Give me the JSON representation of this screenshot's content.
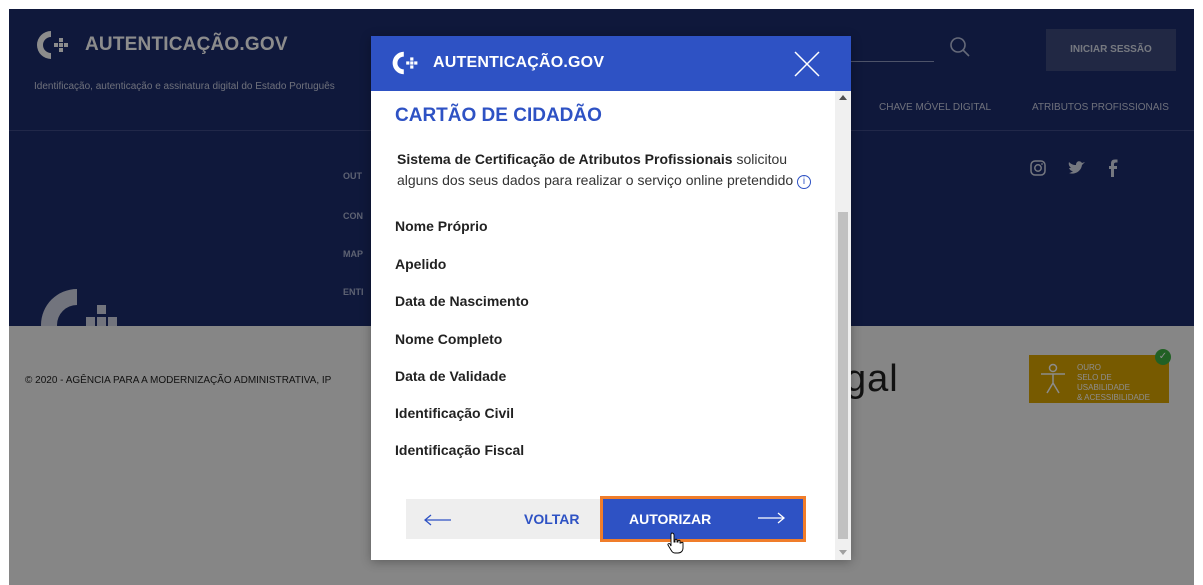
{
  "site": {
    "logo_text": "AUTENTICAÇÃO.GOV",
    "tagline": "Identificação, autenticação e assinatura digital do Estado Português",
    "login_button": "INICIAR SESSÃO",
    "nav": [
      "CHAVE MÓVEL DIGITAL",
      "ATRIBUTOS PROFISSIONAIS"
    ],
    "footer_menu_fragments": [
      "OUT",
      "CON",
      "MAP",
      "ENTI"
    ],
    "copyright": "© 2020 - AGÊNCIA PARA A MODERNIZAÇÃO ADMINISTRATIVA, IP",
    "portugal_fragment": "gal",
    "badge": {
      "line1": "OURO",
      "line2": "SELO DE USABILIDADE",
      "line3": "& ACESSIBILIDADE"
    }
  },
  "modal": {
    "logo_text": "AUTENTICAÇÃO.GOV",
    "title": "CARTÃO DE CIDADÃO",
    "intro_bold": "Sistema de Certificação de Atributos Profissionais",
    "intro_rest": " solicitou alguns dos seus dados para realizar o serviço online pretendido",
    "attributes": [
      "Nome Próprio",
      "Apelido",
      "Data de Nascimento",
      "Nome Completo",
      "Data de Validade",
      "Identificação Civil",
      "Identificação Fiscal"
    ],
    "back_label": "VOLTAR",
    "authorize_label": "AUTORIZAR"
  },
  "colors": {
    "header_blue": "#1d2c6c",
    "modal_blue": "#2e52c4",
    "highlight_orange": "#f07d2a",
    "badge_gold": "#d9a400"
  }
}
